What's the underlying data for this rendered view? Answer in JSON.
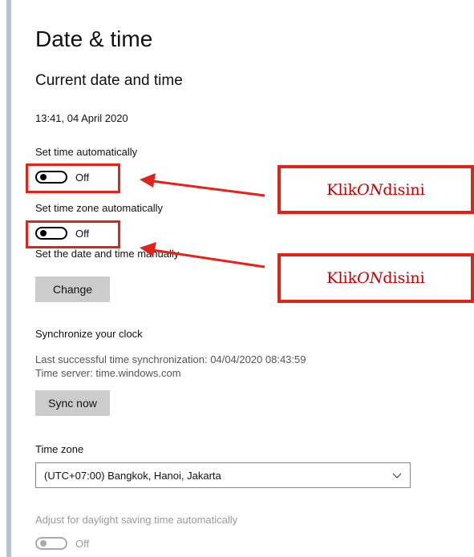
{
  "page": {
    "title": "Date & time",
    "section_title": "Current date and time",
    "current_datetime": "13:41, 04 April 2020"
  },
  "auto_time": {
    "label": "Set time automatically",
    "state": "Off"
  },
  "auto_timezone": {
    "label": "Set time zone automatically",
    "state": "Off"
  },
  "manual": {
    "label": "Set the date and time manually",
    "button": "Change"
  },
  "sync": {
    "heading": "Synchronize your clock",
    "last_sync": "Last successful time synchronization: 04/04/2020 08:43:59",
    "server": "Time server: time.windows.com",
    "button": "Sync now"
  },
  "timezone": {
    "label": "Time zone",
    "selected": "(UTC+07:00) Bangkok, Hanoi, Jakarta"
  },
  "dst": {
    "label": "Adjust for daylight saving time automatically",
    "state": "Off"
  },
  "annotations": {
    "callout_1": {
      "prefix": "Klik ",
      "emph": "ON",
      "suffix": " disini"
    },
    "callout_2": {
      "prefix": "Klik ",
      "emph": "ON",
      "suffix": " disini"
    },
    "color": "#e2231a"
  },
  "icons": {
    "dropdown": "chevron-down-icon",
    "arrow": "arrow-left-icon"
  }
}
